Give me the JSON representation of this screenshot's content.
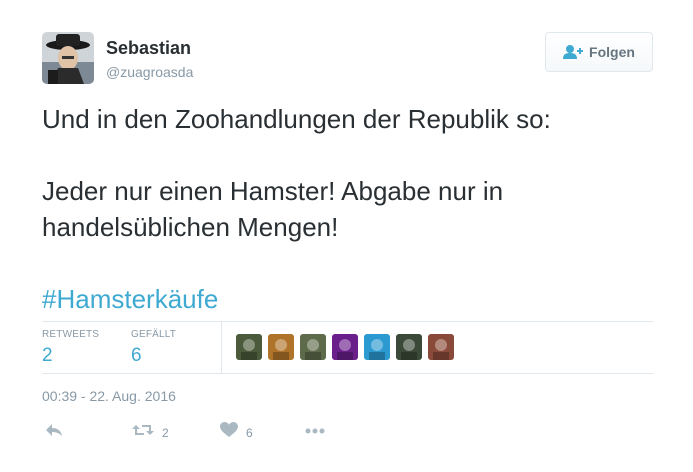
{
  "user": {
    "name": "Sebastian",
    "handle": "@zuagroasda"
  },
  "follow_button": {
    "label": "Folgen",
    "icon": "follow-user-icon"
  },
  "tweet": {
    "line1": "Und in den Zoohandlungen der Republik so:",
    "line2": "Jeder nur einen Hamster! Abgabe nur in",
    "line3": "handelsüblichen Mengen!",
    "hashtag": "#Hamsterkäufe"
  },
  "stats": {
    "retweets_label": "RETWEETS",
    "retweets_count": "2",
    "likes_label": "GEFÄLLT",
    "likes_count": "6"
  },
  "likers": [
    {
      "name": "liker-avatar-1",
      "color": "#4a5a3a"
    },
    {
      "name": "liker-avatar-2",
      "color": "#b0732a"
    },
    {
      "name": "liker-avatar-3",
      "color": "#5e6b4b"
    },
    {
      "name": "liker-avatar-4",
      "color": "#6a1f8a"
    },
    {
      "name": "liker-avatar-5",
      "color": "#2a9ad0"
    },
    {
      "name": "liker-avatar-6",
      "color": "#3b4a38"
    },
    {
      "name": "liker-avatar-7",
      "color": "#8a4a3a"
    }
  ],
  "timestamp": "00:39 - 22. Aug. 2016",
  "actions": {
    "reply_icon": "reply-icon",
    "retweet_icon": "retweet-icon",
    "retweet_count": "2",
    "like_icon": "heart-icon",
    "like_count": "6",
    "more_icon": "more-icon"
  },
  "colors": {
    "accent": "#3ea9d1",
    "text": "#292f33",
    "muted": "#8899a6",
    "border": "#e1e8ed"
  }
}
